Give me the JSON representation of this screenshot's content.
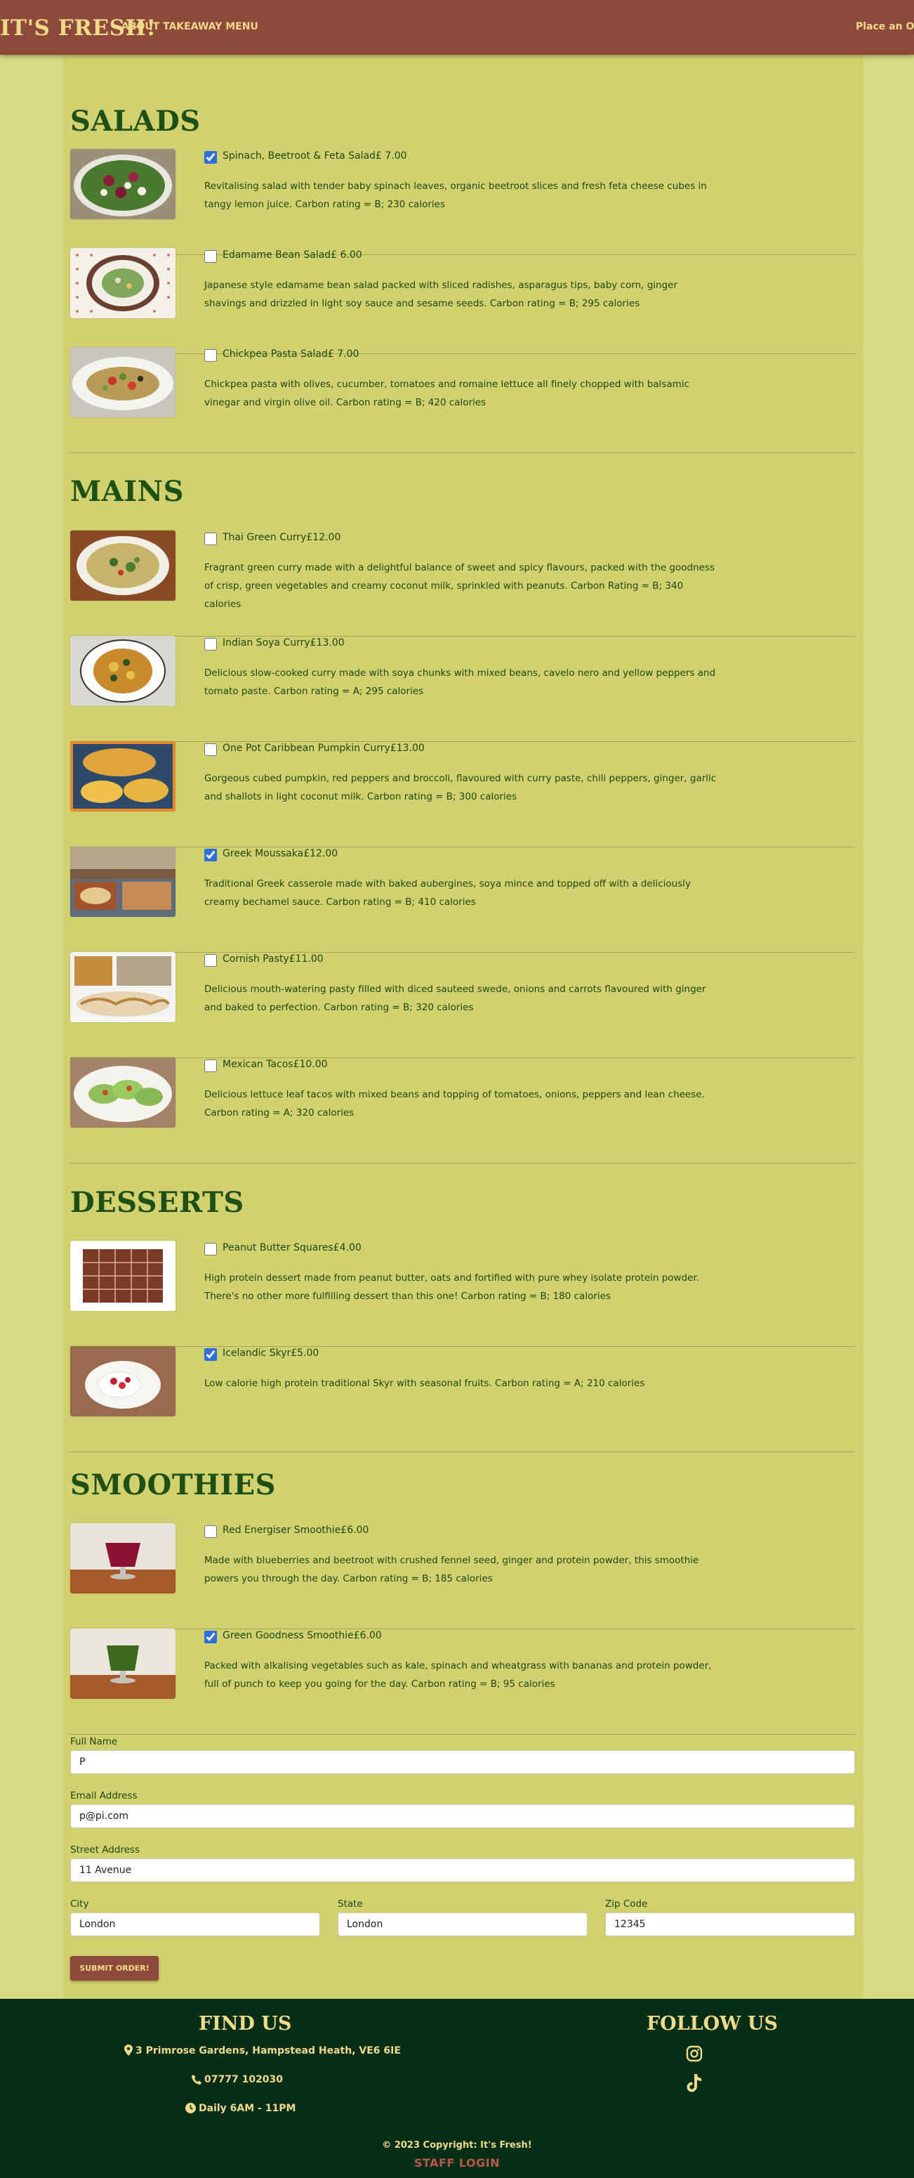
{
  "nav": {
    "brand": "IT'S FRESH!",
    "links": [
      "ABOUT",
      "TAKEAWAY MENU"
    ],
    "order": "Place an Order"
  },
  "sections": {
    "salads": {
      "title": "SALADS",
      "items": [
        {
          "name": "Spinach, Beetroot & Feta Salad£ 7.00",
          "checked": true,
          "desc": "Revitalising salad with tender baby spinach leaves, organic beetroot slices and fresh feta cheese cubes in tangy lemon juice. Carbon rating = B; 230 calories"
        },
        {
          "name": "Edamame Bean Salad£ 6.00",
          "checked": false,
          "desc": "Japanese style edamame bean salad packed with sliced radishes, asparagus tips, baby corn, ginger shavings and drizzled in light soy sauce and sesame seeds. Carbon rating = B; 295 calories"
        },
        {
          "name": "Chickpea Pasta Salad£ 7.00",
          "checked": false,
          "desc": "Chickpea pasta with olives, cucumber, tomatoes and romaine lettuce all finely chopped with balsamic vinegar and virgin olive oil. Carbon rating = B; 420 calories"
        }
      ]
    },
    "mains": {
      "title": "MAINS",
      "items": [
        {
          "name": "Thai Green Curry£12.00",
          "checked": false,
          "desc": "Fragrant green curry made with a delightful balance of sweet and spicy flavours, packed with the goodness of crisp, green vegetables and creamy coconut milk, sprinkled with peanuts. Carbon Rating = B; 340 calories"
        },
        {
          "name": "Indian Soya Curry£13.00",
          "checked": false,
          "desc": "Delicious slow-cooked curry made with soya chunks with mixed beans, cavelo nero and yellow peppers and tomato paste. Carbon rating = A; 295 calories"
        },
        {
          "name": "One Pot Caribbean Pumpkin Curry£13.00",
          "checked": false,
          "desc": "Gorgeous cubed pumpkin, red peppers and broccoli, flavoured with curry paste, chili peppers, ginger, garlic and shallots in light coconut milk. Carbon rating = B; 300 calories"
        },
        {
          "name": "Greek Moussaka£12.00",
          "checked": true,
          "desc": "Traditional Greek casserole made with baked aubergines, soya mince and topped off with a deliciously creamy bechamel sauce. Carbon rating = B; 410 calories"
        },
        {
          "name": "Cornish Pasty£11.00",
          "checked": false,
          "desc": "Delicious mouth-watering pasty filled with diced sauteed swede, onions and carrots flavoured with ginger and baked to perfection. Carbon rating = B; 320 calories"
        },
        {
          "name": "Mexican Tacos£10.00",
          "checked": false,
          "desc": "Delicious lettuce leaf tacos with mixed beans and topping of tomatoes, onions, peppers and lean cheese. Carbon rating = A; 320 calories"
        }
      ]
    },
    "desserts": {
      "title": "DESSERTS",
      "items": [
        {
          "name": "Peanut Butter Squares£4.00",
          "checked": false,
          "desc": "High protein dessert made from peanut butter, oats and fortified with pure whey isolate protein powder. There's no other more fulfilling dessert than this one! Carbon rating = B; 180 calories"
        },
        {
          "name": "Icelandic Skyr£5.00",
          "checked": true,
          "desc": "Low calorie high protein traditional Skyr with seasonal fruits. Carbon rating = A; 210 calories"
        }
      ]
    },
    "smoothies": {
      "title": "SMOOTHIES",
      "items": [
        {
          "name": "Red Energiser Smoothie£6.00",
          "checked": false,
          "desc": "Made with blueberries and beetroot with crushed fennel seed, ginger and protein powder, this smoothie powers you through the day. Carbon rating = B; 185 calories"
        },
        {
          "name": "Green Goodness Smoothie£6.00",
          "checked": true,
          "desc": "Packed with alkalising vegetables such as kale, spinach and wheatgrass with bananas and protein powder, full of punch to keep you going for the day. Carbon rating = B; 95 calories"
        }
      ]
    }
  },
  "form": {
    "fullname": {
      "label": "Full Name",
      "value": "P"
    },
    "email": {
      "label": "Email Address",
      "value": "p@pi.com"
    },
    "street": {
      "label": "Street Address",
      "value": "11 Avenue"
    },
    "city": {
      "label": "City",
      "value": "London"
    },
    "state": {
      "label": "State",
      "value": "London"
    },
    "zip": {
      "label": "Zip Code",
      "value": "12345"
    },
    "submit": "SUBMIT ORDER!"
  },
  "footer": {
    "find_us": "FIND US",
    "address": "3 Primrose Gardens, Hampstead Heath, VE6 6IE",
    "phone": "07777 102030",
    "hours": "Daily 6AM - 11PM",
    "follow_us": "FOLLOW US",
    "copyright": "© 2023 Copyright: It's Fresh!",
    "staff_login": "STAFF LOGIN"
  },
  "colors": {
    "nav": "#8d4a3b",
    "accent": "#f1d98a",
    "page": "#d8d985",
    "content": "#d2d16f",
    "heading": "#1e5016",
    "footer": "#052e18"
  }
}
